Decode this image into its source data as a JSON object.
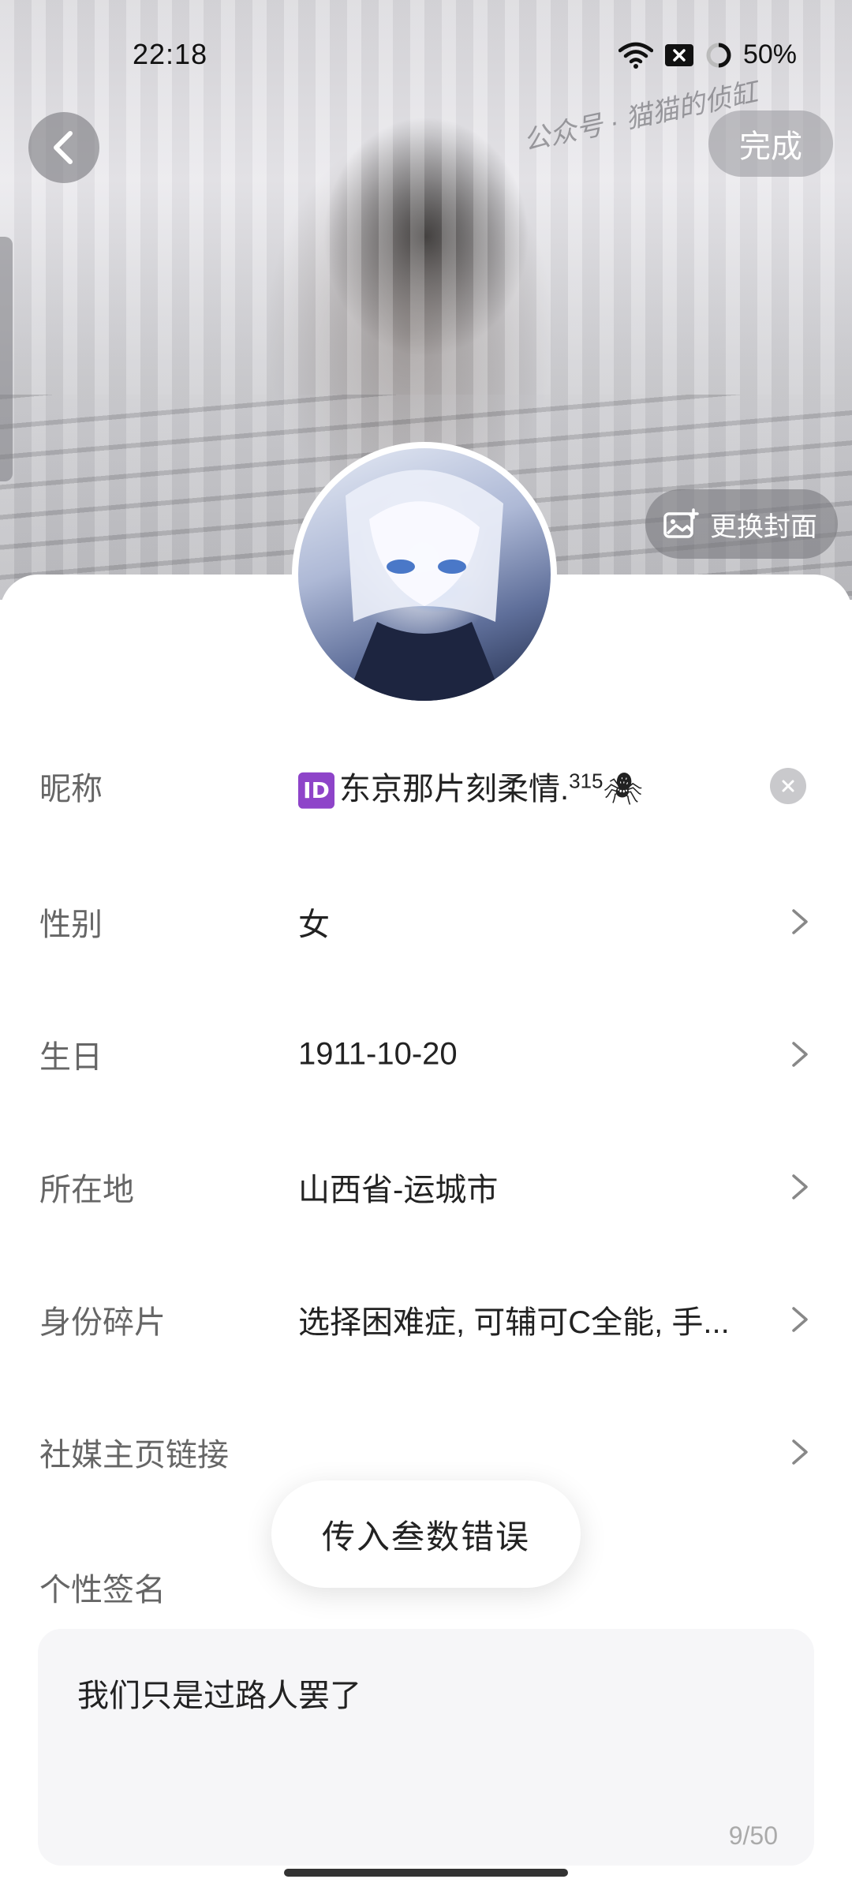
{
  "status_bar": {
    "time": "22:18",
    "battery": "50%",
    "icons": [
      "wifi-icon",
      "sim-off-icon",
      "battery-ring-icon"
    ]
  },
  "header": {
    "done_label": "完成",
    "watermark": "公众号 · 猫猫的侦缸",
    "change_cover_label": "更换封面"
  },
  "form": {
    "nickname": {
      "label": "昵称",
      "badge": "ID",
      "value": "东京那片刻柔情.",
      "superscript": "315",
      "emoji": "🕷"
    },
    "gender": {
      "label": "性别",
      "value": "女"
    },
    "birthday": {
      "label": "生日",
      "value": "1911-10-20"
    },
    "location": {
      "label": "所在地",
      "value": "山西省-运城市"
    },
    "identity": {
      "label": "身份碎片",
      "value": "选择困难症, 可辅可C全能, 手..."
    },
    "social": {
      "label": "社媒主页链接",
      "value": ""
    },
    "signature": {
      "label": "个性签名",
      "value": "我们只是过路人罢了",
      "count": "9/50"
    }
  },
  "toast": {
    "message": "传入叁数错误"
  },
  "colors": {
    "accent_badge": "#8e44c9",
    "label_gray": "#666666",
    "sheet_bg": "#ffffff",
    "input_bg": "#f6f6f8"
  }
}
